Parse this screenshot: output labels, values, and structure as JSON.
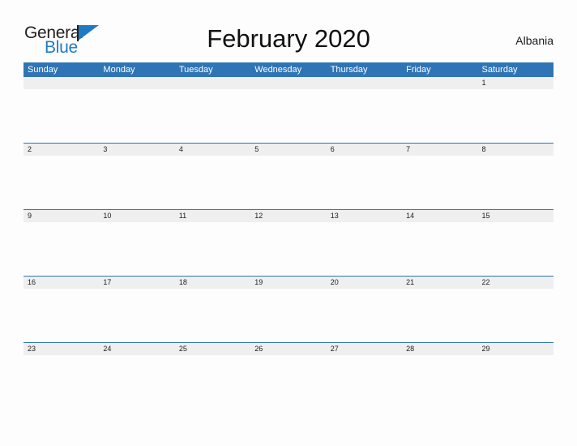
{
  "brand": {
    "name_part1": "General",
    "name_part2": "Blue",
    "flag_icon": "blue-flag-triangle-icon",
    "accent_color": "#1f7ac4"
  },
  "header": {
    "title": "February 2020",
    "country": "Albania"
  },
  "theme": {
    "header_blue": "#2f74b5",
    "date_band_gray": "#efefef",
    "page_background": "#fdfdfd",
    "text_color": "#1c1c1c",
    "weekday_text_color": "#ffffff"
  },
  "calendar": {
    "month": "February",
    "year": "2020",
    "weekday_headers": [
      "Sunday",
      "Monday",
      "Tuesday",
      "Wednesday",
      "Thursday",
      "Friday",
      "Saturday"
    ],
    "weeks": [
      [
        "",
        "",
        "",
        "",
        "",
        "",
        "1"
      ],
      [
        "2",
        "3",
        "4",
        "5",
        "6",
        "7",
        "8"
      ],
      [
        "9",
        "10",
        "11",
        "12",
        "13",
        "14",
        "15"
      ],
      [
        "16",
        "17",
        "18",
        "19",
        "20",
        "21",
        "22"
      ],
      [
        "23",
        "24",
        "25",
        "26",
        "27",
        "28",
        "29"
      ]
    ]
  }
}
